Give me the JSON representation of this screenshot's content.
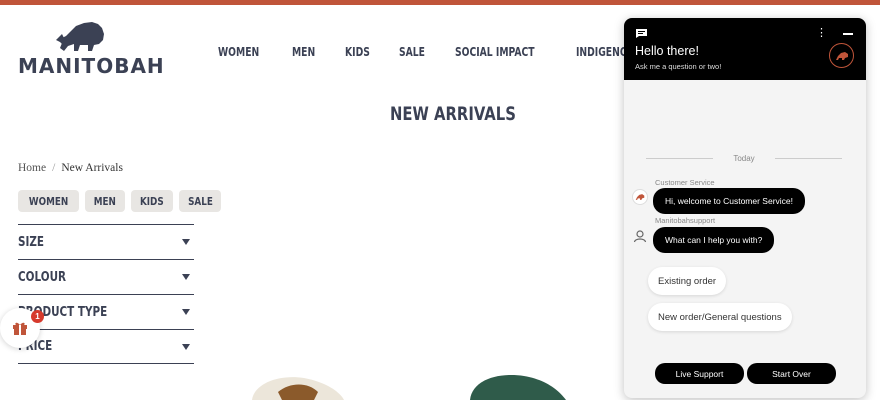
{
  "brand": {
    "name": "MANITOBAH"
  },
  "nav": {
    "items": [
      "WOMEN",
      "MEN",
      "KIDS",
      "SALE",
      "SOCIAL IMPACT",
      "INDIGENOUS MARKET"
    ]
  },
  "page": {
    "title": "NEW ARRIVALS"
  },
  "breadcrumb": {
    "home": "Home",
    "separator": "/",
    "current": "New Arrivals"
  },
  "category_chips": [
    "WOMEN",
    "MEN",
    "KIDS",
    "SALE"
  ],
  "filters": [
    "SIZE",
    "COLOUR",
    "PRODUCT TYPE",
    "PRICE"
  ],
  "gift": {
    "badge_count": "1",
    "icon": "gift-icon"
  },
  "chat": {
    "title": "Hello there!",
    "subtitle": "Ask me a question or two!",
    "day_label": "Today",
    "messages": [
      {
        "sender": "Customer Service",
        "text": "Hi, welcome to Customer Service!"
      },
      {
        "sender": "Manitobahsupport",
        "text": "What can I help you with?"
      }
    ],
    "options": [
      "Existing order",
      "New order/General questions"
    ],
    "buttons": {
      "live_support": "Live Support",
      "start_over": "Start Over"
    }
  },
  "colors": {
    "accent_bar": "#c0553a",
    "nav_text": "#3b4154",
    "chat_header": "#000000",
    "chip_bg": "#e8e6e3",
    "badge": "#d63a2c"
  }
}
